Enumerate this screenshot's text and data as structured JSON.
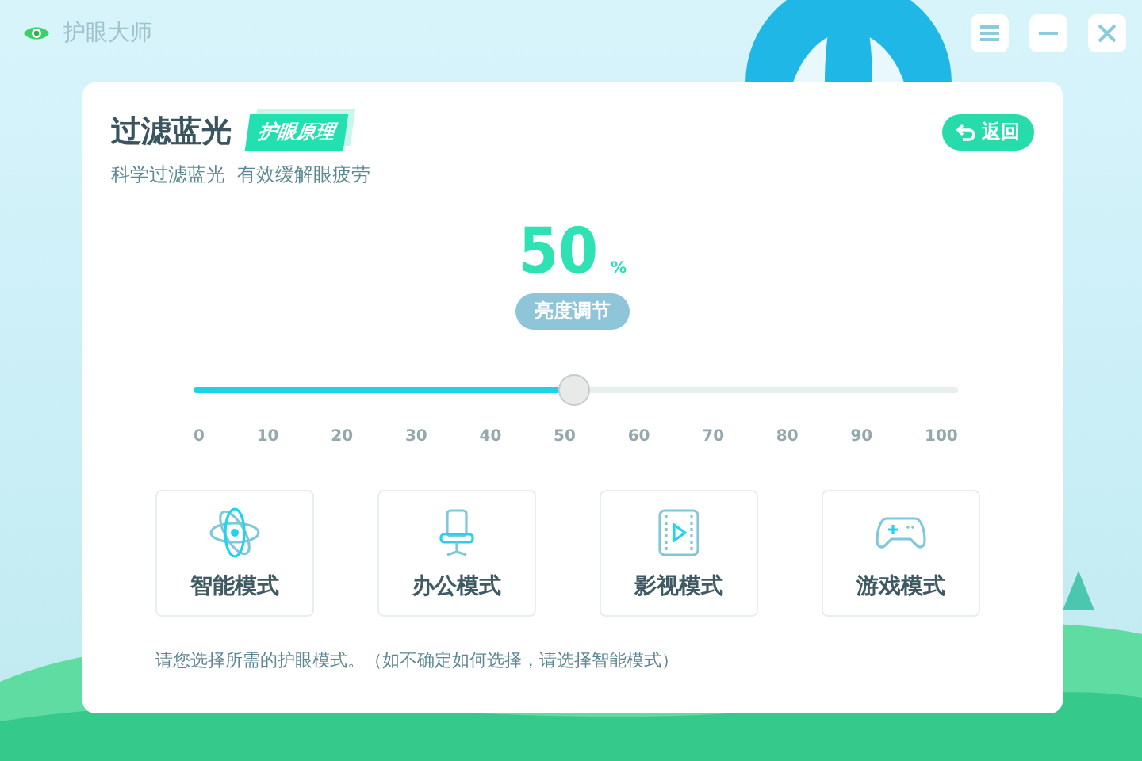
{
  "window": {
    "title": "护眼大师"
  },
  "header": {
    "title": "过滤蓝光",
    "badge": "护眼原理",
    "subtitle": "科学过滤蓝光  有效缓解眼疲劳",
    "back_button": "返回"
  },
  "brightness": {
    "value": "50",
    "unit": "%",
    "label": "亮度调节",
    "level": 0.5,
    "ticks": [
      "0",
      "10",
      "20",
      "30",
      "40",
      "50",
      "60",
      "70",
      "80",
      "90",
      "100"
    ]
  },
  "modes": [
    {
      "kind": "smart",
      "label": "智能模式"
    },
    {
      "kind": "office",
      "label": "办公模式"
    },
    {
      "kind": "movie",
      "label": "影视模式"
    },
    {
      "kind": "game",
      "label": "游戏模式"
    }
  ],
  "hint": "请您选择所需的护眼模式。（如不确定如何选择，请选择智能模式）"
}
